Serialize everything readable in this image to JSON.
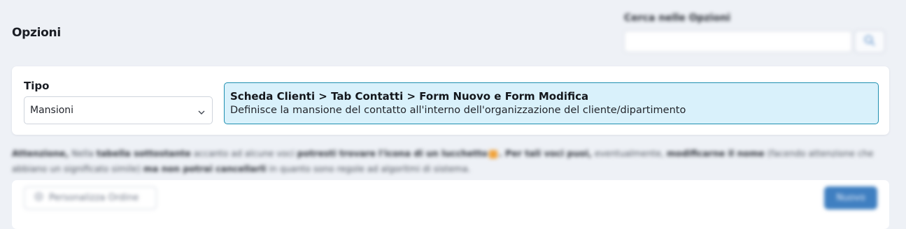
{
  "page": {
    "title": "Opzioni"
  },
  "search": {
    "label": "Cerca nelle Opzioni",
    "placeholder": ""
  },
  "type_card": {
    "label": "Tipo",
    "selected": "Mansioni",
    "info_title": "Scheda Clienti > Tab Contatti > Form Nuovo e Form Modifica",
    "info_description": "Definisce la mansione del contatto all'interno dell'organizzazione del cliente/dipartimento"
  },
  "notice": {
    "p1": "Attenzione,",
    "p2": " Nella ",
    "p3": "tabella sottostante",
    "p4": " accanto ad alcune voci ",
    "p5": "potresti trovare l'icona di un lucchetto",
    "p6": ". Per tali voci puoi,",
    "p7": " eventualmente, ",
    "p8": "modificarne il nome",
    "p9": " (facendo attenzione che abbiano un significato simile) ",
    "p10": "ma non potrai cancellarli",
    "p11": " in quanto sono regole ad algoritmi di sistema."
  },
  "list_toolbar": {
    "custom_order": "Personalizza Ordine",
    "new_button": "Nuovo"
  },
  "icons": {
    "search": "search-icon",
    "chevron": "chevron-down-icon",
    "lock": "lock-icon",
    "order": "settings-icon"
  },
  "colors": {
    "info_bg": "#d9f1fb",
    "info_border": "#1f8fb0",
    "primary": "#3f7fc1"
  }
}
